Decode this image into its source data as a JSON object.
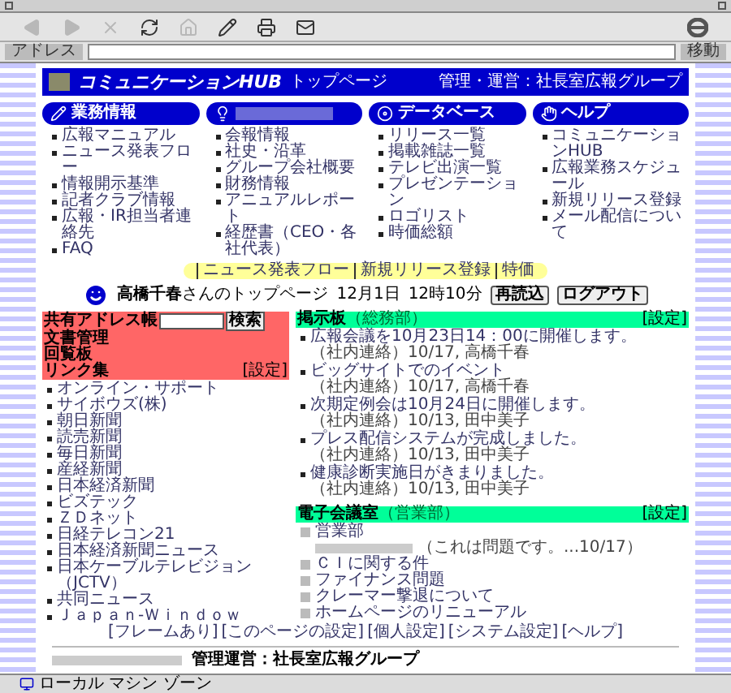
{
  "toolbar": [
    {
      "kind": "back",
      "disabled": true
    },
    {
      "kind": "forward",
      "disabled": true
    },
    {
      "kind": "stop",
      "disabled": true
    },
    {
      "kind": "refresh",
      "disabled": false
    },
    {
      "kind": "home",
      "disabled": true
    },
    {
      "kind": "edit",
      "disabled": false
    },
    {
      "kind": "print",
      "disabled": false
    },
    {
      "kind": "mail",
      "disabled": false
    }
  ],
  "address_bar": {
    "label": "アドレス",
    "go_button": "移動"
  },
  "header": {
    "logo": "コミュニケーションHUB",
    "home_link": "トップページ",
    "admin": "管理・運営：社長室広報グループ"
  },
  "categories": [
    {
      "kind": "pencil",
      "title": "業務情報",
      "items": [
        "広報マニュアル",
        "ニュース発表フロー",
        "情報開示基準",
        "記者クラブ情報",
        "広報・IR担当者連絡先",
        "FAQ"
      ]
    },
    {
      "kind": "bulb",
      "items": [
        "会報情報",
        "社史・沿革",
        "グループ会社概要",
        "財務情報",
        "アニュアルレポート",
        "経歴書（CEO・各社代表）"
      ]
    },
    {
      "kind": "disc",
      "title": "データベース",
      "items": [
        "リリース一覧",
        "掲載雑誌一覧",
        "テレビ出演一覧",
        "プレゼンテーション",
        "ロゴリスト",
        "時価総額"
      ]
    },
    {
      "kind": "hand",
      "title": "ヘルプ",
      "items": [
        "コミュニケーションHUB",
        "広報業務スケジュール",
        "新規リリース登録",
        "メール配信について"
      ]
    }
  ],
  "quick_links": [
    "ニュース発表フロー",
    "新規リリース登録",
    "特価"
  ],
  "user": {
    "greeting": "**高橋千春**さんのトップページ",
    "date": "12月1日",
    "time": "12時10分",
    "buttons": [
      "再読込",
      "ログアウト"
    ]
  },
  "sidebar": {
    "address_book": {
      "label": "共有アドレス帳",
      "button": "検索"
    },
    "menu": [
      "文書管理",
      "回覧板"
    ],
    "links_title": "リンク集",
    "links_setting": "[設定]",
    "links": [
      "オンライン・サポート",
      "サイボウズ(株)",
      "朝日新聞",
      "読売新聞",
      "毎日新聞",
      "産経新聞",
      "日本経済新聞",
      "ビズテック",
      "ＺＤネット",
      "日経テレコン21",
      "日本経済新聞ニュース",
      "日本ケーブルテレビジョン（JCTV）",
      "共同ニュース",
      "Ｊａｐａｎ-Ｗｉｎｄｏｗ"
    ]
  },
  "bulletin": {
    "title": "掲示板",
    "dept": "（総務部）",
    "setting": "[設定]",
    "posts": [
      {
        "title": "広報会議を10月23日14：00に開催します。",
        "meta": "（社内連絡）10/17, 高橋千春"
      },
      {
        "title": "ビッグサイトでのイベント",
        "meta": "（社内連絡）10/17, 高橋千春"
      },
      {
        "title": "次期定例会は10月24日に開催します。",
        "meta": "（社内連絡）10/13, 田中美子"
      },
      {
        "title": "プレス配信システムが完成しました。",
        "meta": "（社内連絡）10/13, 田中美子"
      },
      {
        "title": "健康診断実施日がきまりました。",
        "meta": "（社内連絡）10/13, 田中美子"
      }
    ]
  },
  "forum": {
    "title": "電子会議室",
    "dept": "（営業部）",
    "setting": "[設定]",
    "folder": "営業部",
    "threads": [
      {
        "kind": "reply",
        "text": "（これは問題です。...10/17）"
      },
      {
        "kind": "topic",
        "text": "ＣＩに関する件"
      },
      {
        "kind": "topic",
        "text": "ファイナンス問題"
      },
      {
        "kind": "topic",
        "text": "クレーマー撃退について"
      },
      {
        "kind": "topic",
        "text": "ホームページのリニューアル"
      }
    ]
  },
  "footer": {
    "links": [
      "[フレームあり]",
      "[このページの設定]",
      "[個人設定]",
      "[システム設定]",
      "[ヘルプ]"
    ],
    "admin": "管理運営：社長室広報グループ"
  },
  "status_bar": {
    "zone": "ローカル マシン ゾーン"
  }
}
